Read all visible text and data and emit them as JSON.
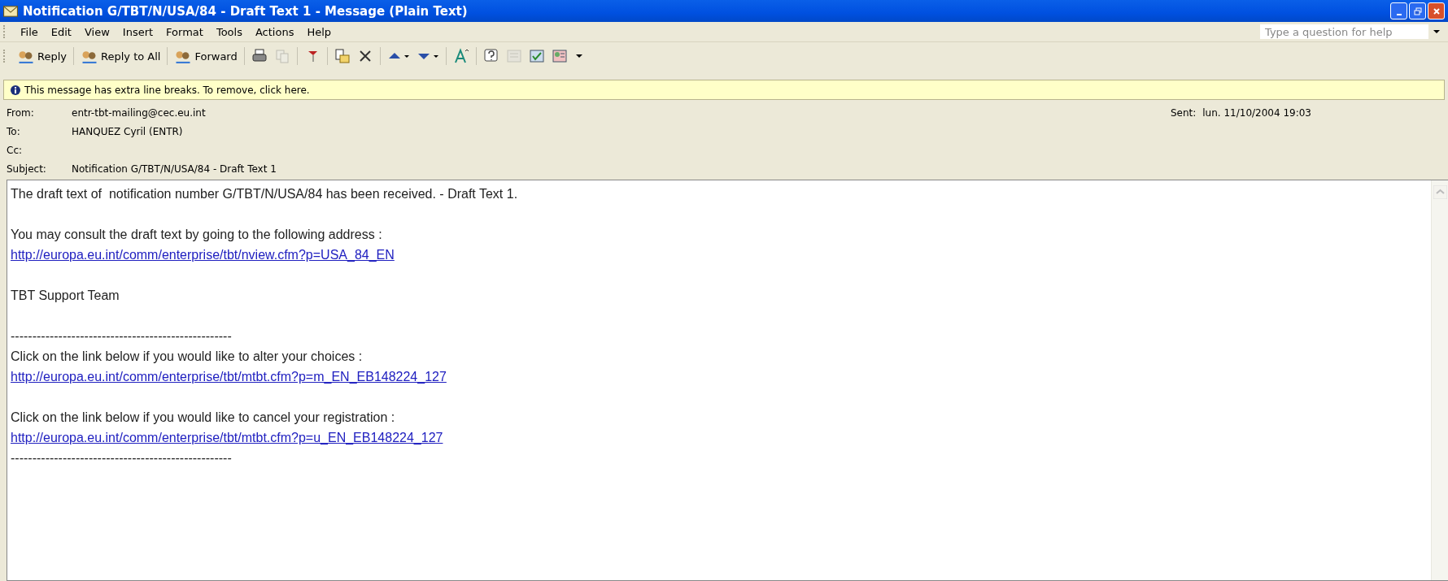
{
  "window": {
    "title": "Notification G/TBT/N/USA/84 - Draft Text 1 - Message (Plain Text)"
  },
  "menu": [
    "File",
    "Edit",
    "View",
    "Insert",
    "Format",
    "Tools",
    "Actions",
    "Help"
  ],
  "help_search": {
    "placeholder": "Type a question for help"
  },
  "toolbar": [
    {
      "kind": "text",
      "label": "Reply"
    },
    {
      "kind": "text",
      "label": "Reply to All"
    },
    {
      "kind": "text",
      "label": "Forward"
    },
    {
      "kind": "icon",
      "disabled": false
    },
    {
      "kind": "icon",
      "disabled": true
    },
    {
      "kind": "icon",
      "disabled": false
    },
    {
      "kind": "icon",
      "disabled": false
    },
    {
      "kind": "icon",
      "disabled": false
    },
    {
      "kind": "icon",
      "disabled": false
    },
    {
      "kind": "icon",
      "disabled": false
    },
    {
      "kind": "icon",
      "disabled": false
    },
    {
      "kind": "icon",
      "disabled": false
    },
    {
      "kind": "icon",
      "disabled": true
    },
    {
      "kind": "icon",
      "disabled": false
    },
    {
      "kind": "icon",
      "disabled": false
    }
  ],
  "info_bar": "This message has extra line breaks. To remove, click here.",
  "header": {
    "fields": [
      {
        "label": "From:",
        "value": "entr-tbt-mailing@cec.eu.int"
      },
      {
        "label": "To:",
        "value": "HANQUEZ Cyril (ENTR)"
      },
      {
        "label": "Cc:"
      },
      {
        "label": "Subject:",
        "value": "Notification G/TBT/N/USA/84 - Draft Text 1"
      }
    ],
    "sent_label": "Sent:",
    "sent_value": "lun. 11/10/2004 19:03"
  },
  "body": [
    {
      "kind": "text",
      "text": "The draft text of  notification number G/TBT/N/USA/84 has been received. - Draft Text 1."
    },
    {
      "kind": "blank"
    },
    {
      "kind": "text",
      "text": "You may consult the draft text by going to the following address :"
    },
    {
      "kind": "link",
      "text": "http://europa.eu.int/comm/enterprise/tbt/nview.cfm?p=USA_84_EN"
    },
    {
      "kind": "blank"
    },
    {
      "kind": "text",
      "text": "TBT Support Team"
    },
    {
      "kind": "blank"
    },
    {
      "kind": "text",
      "text": "---------------------------------------------------"
    },
    {
      "kind": "text",
      "text": "Click on the link below if you would like to alter your choices :"
    },
    {
      "kind": "link",
      "text": "http://europa.eu.int/comm/enterprise/tbt/mtbt.cfm?p=m_EN_EB148224_127"
    },
    {
      "kind": "blank"
    },
    {
      "kind": "text",
      "text": "Click on the link below if you would like to cancel your registration :"
    },
    {
      "kind": "link",
      "text": "http://europa.eu.int/comm/enterprise/tbt/mtbt.cfm?p=u_EN_EB148224_127"
    },
    {
      "kind": "text",
      "text": "---------------------------------------------------"
    }
  ]
}
